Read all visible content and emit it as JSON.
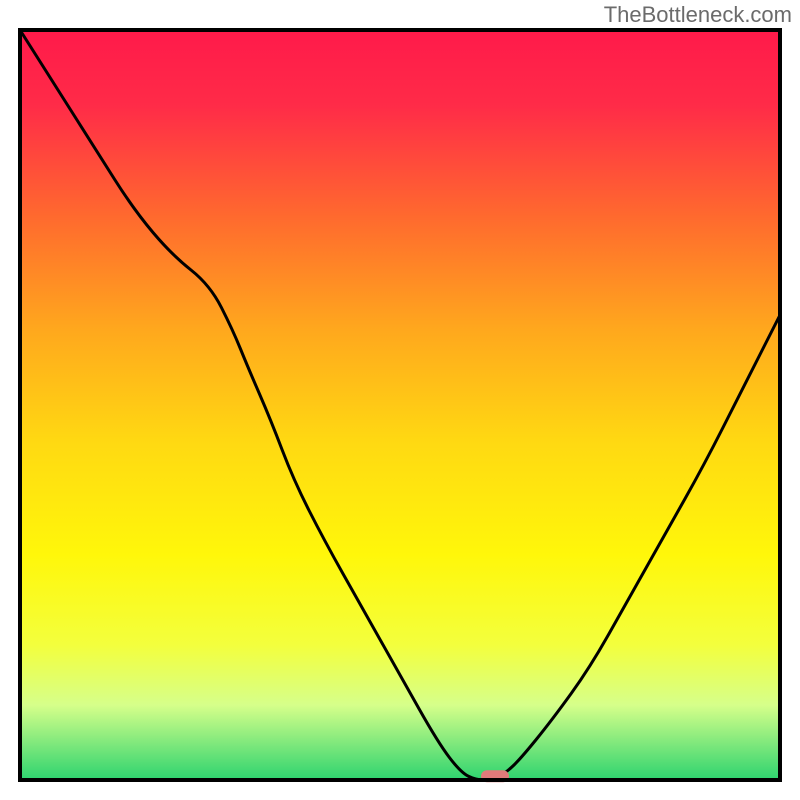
{
  "watermark": "TheBottleneck.com",
  "chart_data": {
    "type": "line",
    "title": "",
    "xlabel": "",
    "ylabel": "",
    "x": [
      0,
      5,
      10,
      15,
      20,
      25,
      28,
      30,
      33,
      36,
      40,
      45,
      50,
      55,
      58,
      60,
      62,
      64,
      66,
      70,
      75,
      80,
      85,
      90,
      95,
      100
    ],
    "values": [
      100,
      92,
      84,
      76,
      70,
      66,
      60,
      55,
      48,
      40,
      32,
      23,
      14,
      5,
      1,
      0,
      0,
      1,
      3,
      8,
      15,
      24,
      33,
      42,
      52,
      62
    ],
    "xlim": [
      0,
      100
    ],
    "ylim": [
      0,
      100
    ],
    "gradient_stops": [
      {
        "offset": 0,
        "color": "#ff1a4a"
      },
      {
        "offset": 10,
        "color": "#ff2b48"
      },
      {
        "offset": 25,
        "color": "#ff6a2e"
      },
      {
        "offset": 40,
        "color": "#ffa81d"
      },
      {
        "offset": 55,
        "color": "#ffd912"
      },
      {
        "offset": 70,
        "color": "#fff70a"
      },
      {
        "offset": 82,
        "color": "#f3ff3d"
      },
      {
        "offset": 90,
        "color": "#d6ff8a"
      },
      {
        "offset": 100,
        "color": "#2dd36f"
      }
    ],
    "marker": {
      "x": 62.5,
      "y": 0.5,
      "color": "#e07a7a"
    },
    "frame_color": "#000000",
    "curve_color": "#000000"
  }
}
